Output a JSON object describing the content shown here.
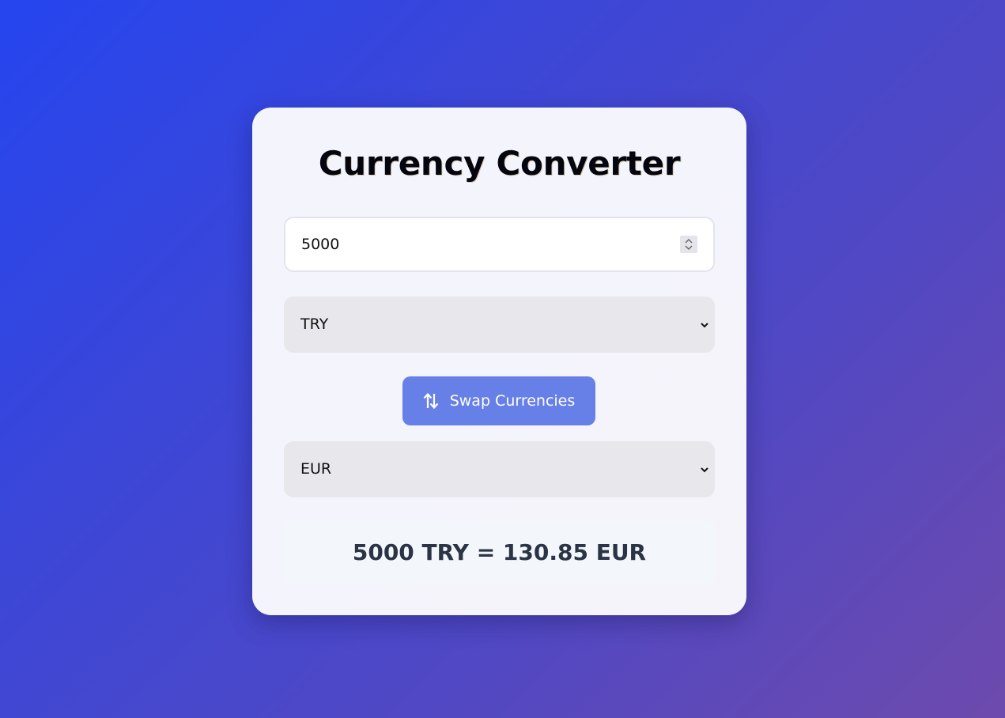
{
  "app": {
    "title": "Currency Converter"
  },
  "amount": {
    "value": "5000"
  },
  "from_currency": {
    "selected": "TRY"
  },
  "swap_button": {
    "label": "Swap Currencies",
    "icon": "swap-vertical-arrows-icon"
  },
  "to_currency": {
    "selected": "EUR"
  },
  "result": {
    "text": "5000 TRY = 130.85 EUR"
  },
  "colors": {
    "background_start": "#2545ef",
    "background_end": "#6d4aad",
    "button": "#6780e7",
    "select_bg": "#e8e7ec",
    "result_text": "#2b3445"
  }
}
